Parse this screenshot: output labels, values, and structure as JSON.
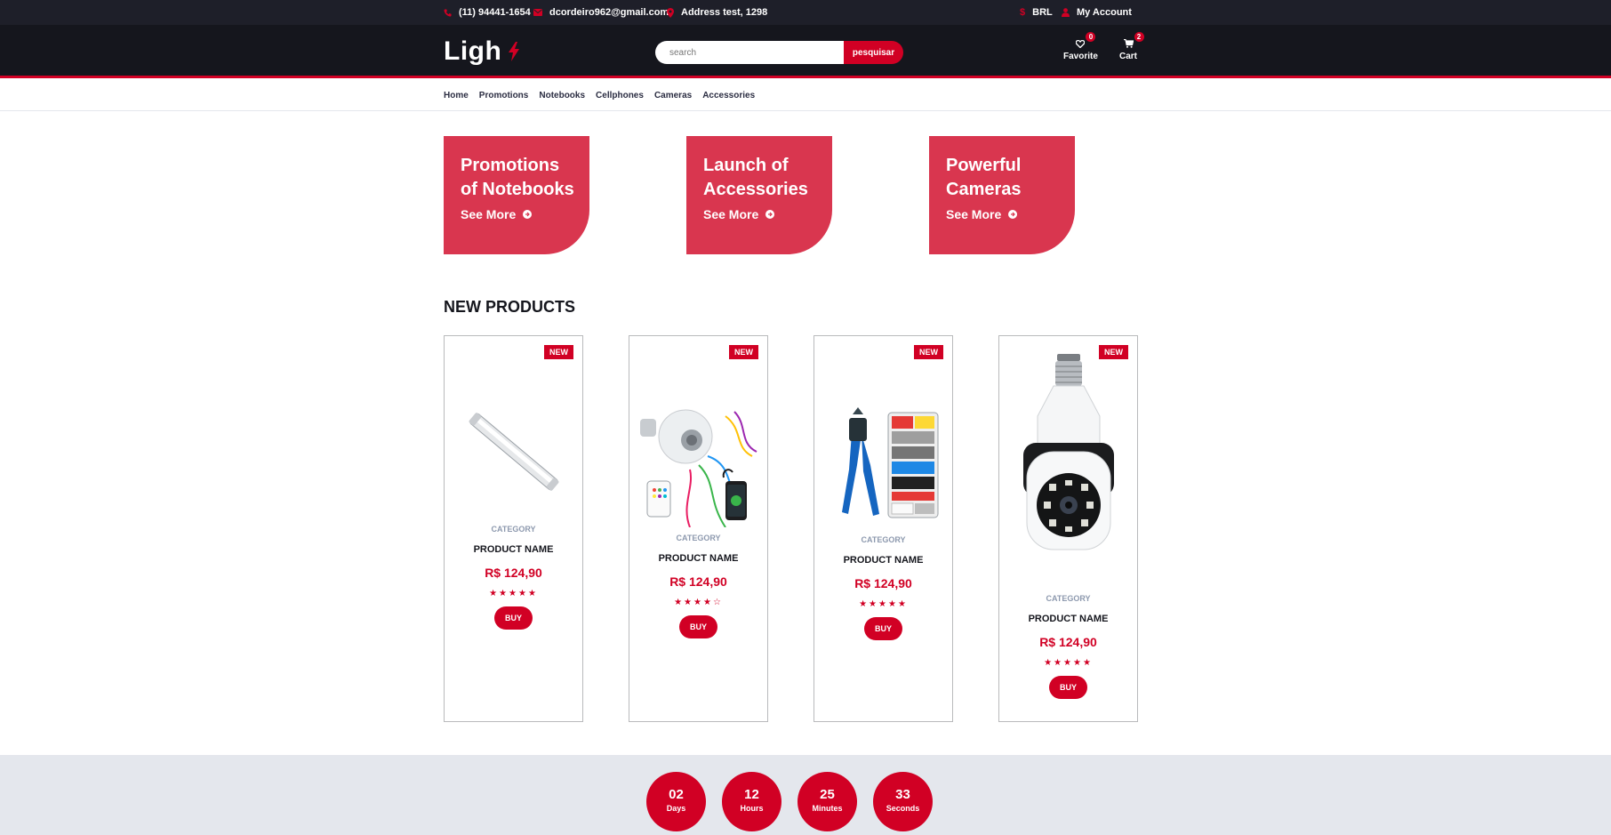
{
  "topbar": {
    "phone": "(11) 94441-1654",
    "email": "dcordeiro962@gmail.com",
    "address": "Address test, 1298",
    "currency": "BRL",
    "account": "My Account"
  },
  "header": {
    "logo": "Ligh",
    "search_placeholder": "search",
    "search_button": "pesquisar",
    "favorite_label": "Favorite",
    "favorite_count": "0",
    "cart_label": "Cart",
    "cart_count": "2"
  },
  "nav": [
    "Home",
    "Promotions",
    "Notebooks",
    "Cellphones",
    "Cameras",
    "Accessories"
  ],
  "promos": [
    {
      "title_1": "Promotions",
      "title_2": "of Notebooks",
      "link": "See More"
    },
    {
      "title_1": "Launch of",
      "title_2": "Accessories",
      "link": "See More"
    },
    {
      "title_1": "Powerful",
      "title_2": "Cameras",
      "link": "See More"
    }
  ],
  "section_title": "NEW PRODUCTS",
  "products": [
    {
      "badge": "NEW",
      "category": "CATEGORY",
      "name": "PRODUCT NAME",
      "price": "R$ 124,90",
      "rating": "★★★★★",
      "rating_value": 5,
      "buy": "BUY",
      "image": "led-tube-light"
    },
    {
      "badge": "NEW",
      "category": "CATEGORY",
      "name": "PRODUCT NAME",
      "price": "R$ 124,90",
      "rating": "★★★★☆",
      "rating_value": 4,
      "buy": "BUY",
      "image": "speaker-bulb"
    },
    {
      "badge": "NEW",
      "category": "CATEGORY",
      "name": "PRODUCT NAME",
      "price": "R$ 124,90",
      "rating": "★★★★★",
      "rating_value": 5,
      "buy": "BUY",
      "image": "crimping-tool-kit"
    },
    {
      "badge": "NEW",
      "category": "CATEGORY",
      "name": "PRODUCT NAME",
      "price": "R$ 124,90",
      "rating": "★★★★★",
      "rating_value": 5,
      "buy": "BUY",
      "image": "bulb-security-camera"
    }
  ],
  "countdown": [
    {
      "value": "02",
      "unit": "Days"
    },
    {
      "value": "12",
      "unit": "Hours"
    },
    {
      "value": "25",
      "unit": "Minutes"
    },
    {
      "value": "33",
      "unit": "Seconds"
    }
  ],
  "colors": {
    "accent": "#d10024",
    "promo": "#d9364f",
    "header_bg": "#15161d",
    "topbar_bg": "#1e1f29",
    "band_bg": "#e4e7ed"
  }
}
